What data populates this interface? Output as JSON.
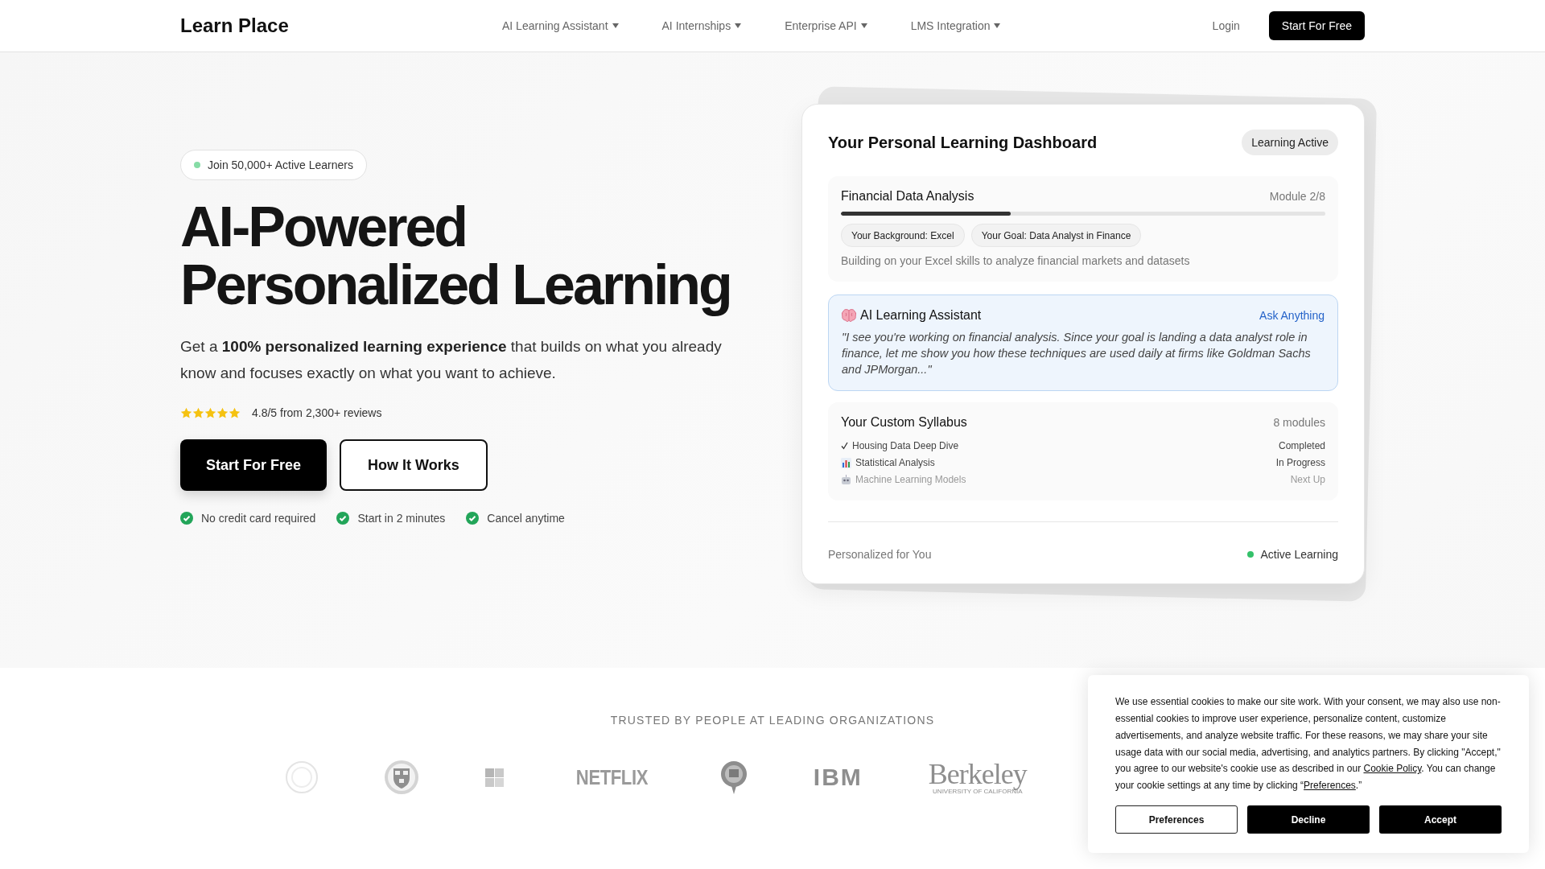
{
  "header": {
    "brand": "Learn Place",
    "nav": [
      {
        "label": "AI Learning Assistant"
      },
      {
        "label": "AI Internships"
      },
      {
        "label": "Enterprise API"
      },
      {
        "label": "LMS Integration"
      }
    ],
    "login": "Login",
    "cta": "Start For Free"
  },
  "hero": {
    "badge": "Join 50,000+ Active Learners",
    "title_lines": [
      "AI-Powered",
      "Personalized Learning"
    ],
    "subtitle": "Get a **100% personalized learning experience** that builds on what you already know and focuses exactly on what you want to achieve.",
    "rating": {
      "stars": 5,
      "text": "4.8/5 from 2,300+ reviews"
    },
    "buttons": [
      {
        "label": "Start For Free",
        "kind": "primary"
      },
      {
        "label": "How It Works",
        "kind": "secondary"
      }
    ],
    "perks": [
      "No credit card required",
      "Start in 2 minutes",
      "Cancel anytime"
    ]
  },
  "dashboard": {
    "title": "Your Personal Learning Dashboard",
    "status": "Learning Active",
    "course": {
      "name": "Financial Data Analysis",
      "module": "Module 2/8",
      "progress": {
        "level": 0.35
      },
      "tags": [
        "Your Background: Excel",
        "Your Goal: Data Analyst in Finance"
      ],
      "description": "Building on your Excel skills to analyze financial markets and datasets"
    },
    "assistant": {
      "title": "AI Learning Assistant",
      "action": "Ask Anything",
      "message": "\"I see you're working on financial analysis. Since your goal is landing a data analyst role in finance, let me show you how these techniques are used daily at firms like Goldman Sachs and JPMorgan...\""
    },
    "syllabus": {
      "title": "Your Custom Syllabus",
      "count": "8 modules",
      "items": [
        {
          "name": "Housing Data Deep Dive",
          "status": "Completed",
          "kind": "done"
        },
        {
          "name": "Statistical Analysis",
          "status": "In Progress",
          "kind": "current"
        },
        {
          "name": "Machine Learning Models",
          "status": "Next Up",
          "kind": "upcoming"
        }
      ]
    },
    "footer": {
      "left": "Personalized for You",
      "right": "Active Learning"
    }
  },
  "logos": {
    "heading": "TRUSTED BY PEOPLE AT LEADING ORGANIZATIONS",
    "items": [
      {
        "kind": "seal"
      },
      {
        "kind": "crest"
      },
      {
        "kind": "squares"
      },
      {
        "kind": "condensed",
        "text": "NETFLIX"
      },
      {
        "kind": "medallion"
      },
      {
        "kind": "striped",
        "text": "IBM"
      },
      {
        "kind": "serif",
        "text": "Berkeley",
        "subtext": "UNIVERSITY OF CALIFORNIA"
      }
    ]
  },
  "cookie": {
    "parts": [
      {
        "kind": "text",
        "text": "We use essential cookies to make our site work. With your consent, we may also use non-essential cookies to improve user experience, personalize content, customize advertisements, and analyze website traffic. For these reasons, we may share your site usage data with our social media, advertising, and analytics partners. By clicking \"Accept,\" you agree to our website's cookie use as described in our "
      },
      {
        "kind": "link",
        "text": "Cookie Policy"
      },
      {
        "kind": "text",
        "text": ". You can change your cookie settings at any time by clicking “"
      },
      {
        "kind": "link",
        "text": "Preferences"
      },
      {
        "kind": "text",
        "text": ".”"
      }
    ],
    "buttons": [
      {
        "label": "Preferences",
        "kind": "outline"
      },
      {
        "label": "Decline",
        "kind": "filled"
      },
      {
        "label": "Accept",
        "kind": "filled"
      }
    ]
  }
}
